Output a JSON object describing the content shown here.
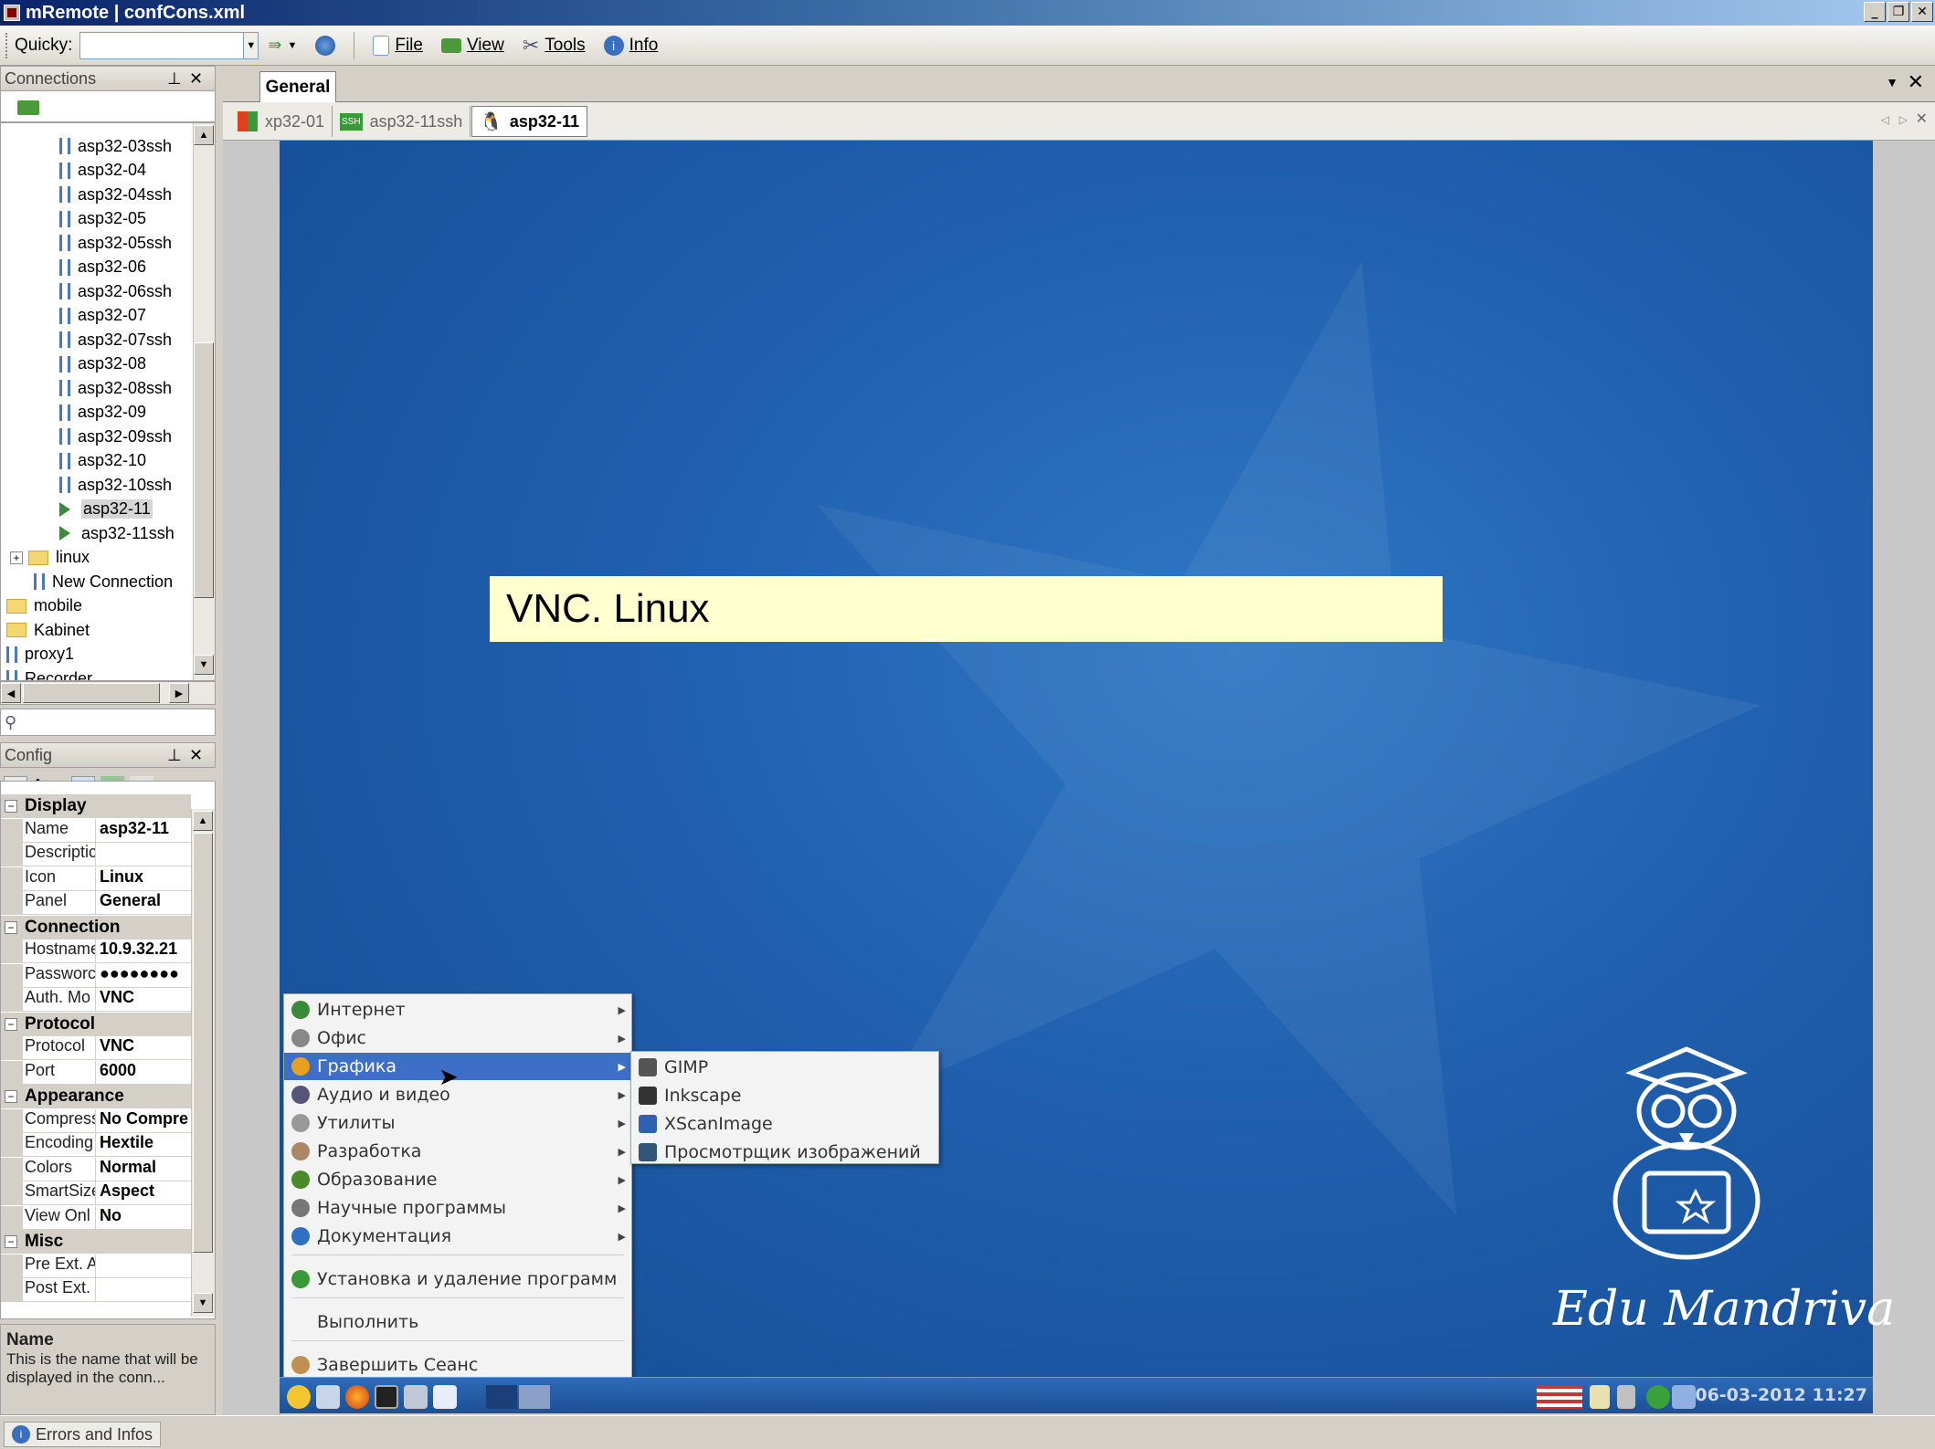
{
  "window": {
    "title": "mRemote | confCons.xml",
    "controls": [
      "_",
      "❐",
      "✕"
    ]
  },
  "toolbar": {
    "quicky_label": "Quicky:",
    "quicky_value": "",
    "file_label": "File",
    "view_label": "View",
    "tools_label": "Tools",
    "info_label": "Info"
  },
  "connections_panel": {
    "title": "Connections",
    "pin": "♂",
    "close": "✕",
    "items": [
      {
        "label": "asp32-03ssh",
        "type": "conn"
      },
      {
        "label": "asp32-04",
        "type": "conn"
      },
      {
        "label": "asp32-04ssh",
        "type": "conn"
      },
      {
        "label": "asp32-05",
        "type": "conn"
      },
      {
        "label": "asp32-05ssh",
        "type": "conn"
      },
      {
        "label": "asp32-06",
        "type": "conn"
      },
      {
        "label": "asp32-06ssh",
        "type": "conn"
      },
      {
        "label": "asp32-07",
        "type": "conn"
      },
      {
        "label": "asp32-07ssh",
        "type": "conn"
      },
      {
        "label": "asp32-08",
        "type": "conn"
      },
      {
        "label": "asp32-08ssh",
        "type": "conn"
      },
      {
        "label": "asp32-09",
        "type": "conn"
      },
      {
        "label": "asp32-09ssh",
        "type": "conn"
      },
      {
        "label": "asp32-10",
        "type": "conn"
      },
      {
        "label": "asp32-10ssh",
        "type": "conn"
      },
      {
        "label": "asp32-11",
        "type": "active"
      },
      {
        "label": "asp32-11ssh",
        "type": "active"
      },
      {
        "label": "linux",
        "type": "folder"
      },
      {
        "label": "New Connection",
        "type": "conn"
      },
      {
        "label": "mobile",
        "type": "folder"
      },
      {
        "label": "Kabinet",
        "type": "folder"
      },
      {
        "label": "proxy1",
        "type": "conn"
      },
      {
        "label": "Recorder",
        "type": "conn"
      }
    ],
    "search_value": ""
  },
  "config_panel": {
    "title": "Config",
    "sections": [
      {
        "name": "Display",
        "rows": [
          {
            "key": "Name",
            "value": "asp32-11"
          },
          {
            "key": "Descriptic",
            "value": ""
          },
          {
            "key": "Icon",
            "value": "Linux"
          },
          {
            "key": "Panel",
            "value": "General"
          }
        ]
      },
      {
        "name": "Connection",
        "rows": [
          {
            "key": "Hostname",
            "value": "10.9.32.21"
          },
          {
            "key": "Passworc",
            "value": "●●●●●●●●"
          },
          {
            "key": "Auth. Mo",
            "value": "VNC"
          }
        ]
      },
      {
        "name": "Protocol",
        "rows": [
          {
            "key": "Protocol",
            "value": "VNC"
          },
          {
            "key": "Port",
            "value": "6000"
          }
        ]
      },
      {
        "name": "Appearance",
        "rows": [
          {
            "key": "Compress",
            "value": "No Compre"
          },
          {
            "key": "Encoding",
            "value": "Hextile"
          },
          {
            "key": "Colors",
            "value": "Normal"
          },
          {
            "key": "SmartSize",
            "value": "Aspect"
          },
          {
            "key": "View Onl",
            "value": "No"
          }
        ]
      },
      {
        "name": "Misc",
        "rows": [
          {
            "key": "Pre Ext. A",
            "value": ""
          },
          {
            "key": "Post Ext.",
            "value": ""
          }
        ]
      }
    ],
    "description_title": "Name",
    "description_text": "This is the name that will be displayed in the conn..."
  },
  "main": {
    "panel_tab": "General",
    "connection_tabs": [
      {
        "label": "xp32-01",
        "active": false
      },
      {
        "label": "asp32-11ssh",
        "active": false
      },
      {
        "label": "asp32-11",
        "active": true
      }
    ],
    "ssh_badge": "SSH"
  },
  "remote": {
    "banner": "VNC. Linux",
    "menu": [
      {
        "label": "Интернет",
        "color": "#3a8a3a",
        "submenu": true
      },
      {
        "label": "Офис",
        "color": "#888888",
        "submenu": true
      },
      {
        "label": "Графика",
        "color": "#e8a020",
        "submenu": true,
        "highlight": true
      },
      {
        "label": "Аудио и видео",
        "color": "#555577",
        "submenu": true
      },
      {
        "label": "Утилиты",
        "color": "#999999",
        "submenu": true
      },
      {
        "label": "Разработка",
        "color": "#aa8866",
        "submenu": true
      },
      {
        "label": "Образование",
        "color": "#4a8a2a",
        "submenu": true
      },
      {
        "label": "Научные программы",
        "color": "#777777",
        "submenu": true
      },
      {
        "label": "Документация",
        "color": "#3070c0",
        "submenu": true
      },
      {
        "label": "Установка и удаление программ",
        "color": "#3a9a3a",
        "submenu": false
      },
      {
        "label": "Выполнить",
        "color": "",
        "submenu": false
      },
      {
        "label": "Завершить Сеанс",
        "color": "#c09050",
        "submenu": false
      }
    ],
    "submenu": [
      {
        "label": "GIMP"
      },
      {
        "label": "Inkscape"
      },
      {
        "label": "XScanImage"
      },
      {
        "label": "Просмотрщик изображений"
      }
    ],
    "brand": "Edu Mandriva",
    "clock": "06-03-2012 11:27"
  },
  "statusbar": {
    "errors_label": "Errors and Infos"
  }
}
